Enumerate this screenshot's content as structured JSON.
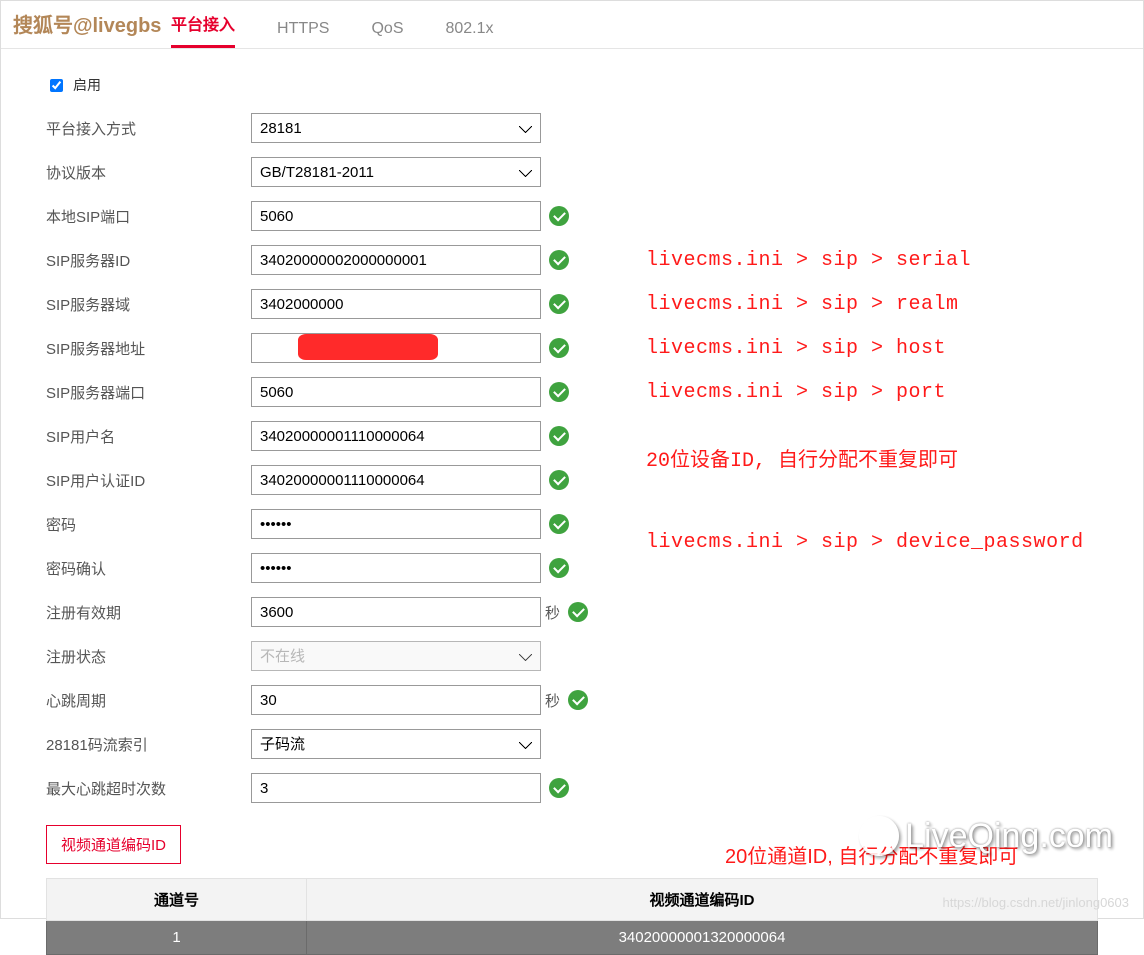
{
  "watermark_top": "搜狐号@livegbs",
  "tabs": {
    "platform": "平台接入",
    "https": "HTTPS",
    "qos": "QoS",
    "dot1x": "802.1x"
  },
  "form": {
    "enable_label": "启用",
    "access_method_label": "平台接入方式",
    "access_method_value": "28181",
    "protocol_label": "协议版本",
    "protocol_value": "GB/T28181-2011",
    "local_sip_port_label": "本地SIP端口",
    "local_sip_port_value": "5060",
    "sip_server_id_label": "SIP服务器ID",
    "sip_server_id_value": "34020000002000000001",
    "sip_server_realm_label": "SIP服务器域",
    "sip_server_realm_value": "3402000000",
    "sip_server_addr_label": "SIP服务器地址",
    "sip_server_addr_value": "",
    "sip_server_port_label": "SIP服务器端口",
    "sip_server_port_value": "5060",
    "sip_user_label": "SIP用户名",
    "sip_user_value": "34020000001110000064",
    "sip_auth_id_label": "SIP用户认证ID",
    "sip_auth_id_value": "34020000001110000064",
    "pwd_label": "密码",
    "pwd_value": "••••••",
    "pwd2_label": "密码确认",
    "pwd2_value": "••••••",
    "reg_exp_label": "注册有效期",
    "reg_exp_value": "3600",
    "reg_exp_unit": "秒",
    "reg_status_label": "注册状态",
    "reg_status_value": "不在线",
    "heartbeat_label": "心跳周期",
    "heartbeat_value": "30",
    "heartbeat_unit": "秒",
    "stream_idx_label": "28181码流索引",
    "stream_idx_value": "子码流",
    "max_hb_timeout_label": "最大心跳超时次数",
    "max_hb_timeout_value": "3",
    "video_ch_btn": "视频通道编码ID"
  },
  "notes": {
    "serial": "livecms.ini > sip > serial",
    "realm": "livecms.ini > sip > realm",
    "host": "livecms.ini > sip > host",
    "port": "livecms.ini > sip > port",
    "device_id": "20位设备ID, 自行分配不重复即可",
    "device_password": "livecms.ini > sip > device_password",
    "channel_id": "20位通道ID, 自行分配不重复即可"
  },
  "table": {
    "col_channel": "通道号",
    "col_chid": "视频通道编码ID",
    "row1_channel": "1",
    "row1_chid": "34020000001320000064"
  },
  "brand": "LiveQing.com",
  "csdn": "https://blog.csdn.net/jinlong0603"
}
